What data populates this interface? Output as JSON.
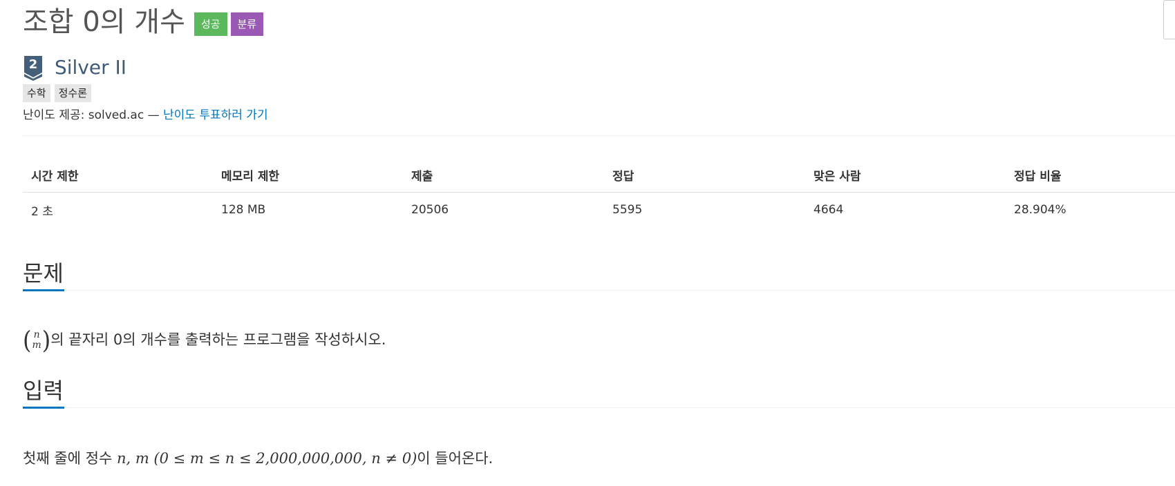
{
  "problem": {
    "title": "조합 0의 개수",
    "badges": {
      "success": "성공",
      "classify": "분류"
    }
  },
  "tier": {
    "level": "2",
    "name": "Silver II"
  },
  "tags": [
    "수학",
    "정수론"
  ],
  "credit": {
    "prefix": "난이도 제공: solved.ac —",
    "link": "난이도 투표하러 가기"
  },
  "stats": {
    "headers": [
      "시간 제한",
      "메모리 제한",
      "제출",
      "정답",
      "맞은 사람",
      "정답 비율"
    ],
    "values": [
      "2 초",
      "128 MB",
      "20506",
      "5595",
      "4664",
      "28.904%"
    ]
  },
  "sections": {
    "problem": {
      "title": "문제",
      "binom_top": "n",
      "binom_bottom": "m",
      "text": "의 끝자리 0의 개수를 출력하는 프로그램을 작성하시오."
    },
    "input": {
      "title": "입력",
      "text_before": "첫째 줄에 정수 ",
      "math": "n, m (0 ≤ m ≤ n ≤ 2,000,000,000, n ≠ 0)",
      "text_after": "이 들어온다."
    }
  },
  "colors": {
    "success": "#5cb85c",
    "classify": "#9b59b6",
    "tier": "#3f5b7a",
    "link": "#0076c0"
  }
}
